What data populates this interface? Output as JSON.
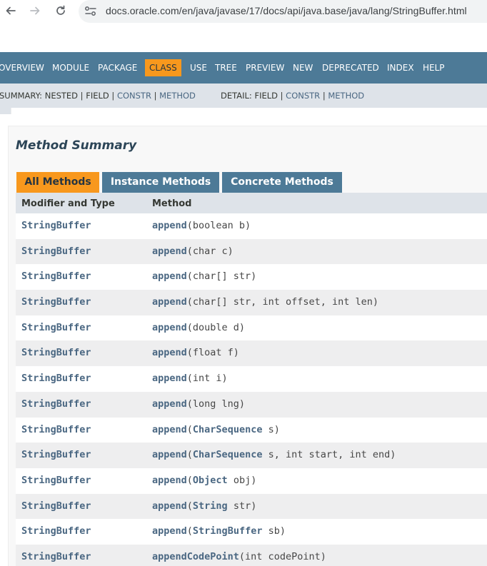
{
  "browser": {
    "url": "docs.oracle.com/en/java/javase/17/docs/api/java.base/java/lang/StringBuffer.html"
  },
  "navbar": {
    "items": [
      "OVERVIEW",
      "MODULE",
      "PACKAGE",
      "CLASS",
      "USE",
      "TREE",
      "PREVIEW",
      "NEW",
      "DEPRECATED",
      "INDEX",
      "HELP"
    ],
    "active": "CLASS"
  },
  "subnav": {
    "summary_prefix": "SUMMARY: NESTED | FIELD | ",
    "summary_constr": "CONSTR",
    "summary_sep": " | ",
    "summary_method": "METHOD",
    "detail_prefix": "DETAIL: FIELD | ",
    "detail_constr": "CONSTR",
    "detail_sep": " | ",
    "detail_method": "METHOD"
  },
  "section": {
    "title": "Method Summary",
    "tabs": [
      "All Methods",
      "Instance Methods",
      "Concrete Methods"
    ],
    "columns": [
      "Modifier and Type",
      "Method"
    ],
    "rows": [
      {
        "type": "StringBuffer",
        "name": "append",
        "sig": [
          [
            "(boolean b)",
            false
          ]
        ]
      },
      {
        "type": "StringBuffer",
        "name": "append",
        "sig": [
          [
            "(char c)",
            false
          ]
        ]
      },
      {
        "type": "StringBuffer",
        "name": "append",
        "sig": [
          [
            "(char[] str)",
            false
          ]
        ]
      },
      {
        "type": "StringBuffer",
        "name": "append",
        "sig": [
          [
            "(char[] str, int offset, int len)",
            false
          ]
        ]
      },
      {
        "type": "StringBuffer",
        "name": "append",
        "sig": [
          [
            "(double d)",
            false
          ]
        ]
      },
      {
        "type": "StringBuffer",
        "name": "append",
        "sig": [
          [
            "(float f)",
            false
          ]
        ]
      },
      {
        "type": "StringBuffer",
        "name": "append",
        "sig": [
          [
            "(int i)",
            false
          ]
        ]
      },
      {
        "type": "StringBuffer",
        "name": "append",
        "sig": [
          [
            "(long lng)",
            false
          ]
        ]
      },
      {
        "type": "StringBuffer",
        "name": "append",
        "sig": [
          [
            "(",
            false
          ],
          [
            "CharSequence",
            true
          ],
          [
            " s)",
            false
          ]
        ]
      },
      {
        "type": "StringBuffer",
        "name": "append",
        "sig": [
          [
            "(",
            false
          ],
          [
            "CharSequence",
            true
          ],
          [
            " s, int start, int end)",
            false
          ]
        ]
      },
      {
        "type": "StringBuffer",
        "name": "append",
        "sig": [
          [
            "(",
            false
          ],
          [
            "Object",
            true
          ],
          [
            " obj)",
            false
          ]
        ]
      },
      {
        "type": "StringBuffer",
        "name": "append",
        "sig": [
          [
            "(",
            false
          ],
          [
            "String",
            true
          ],
          [
            " str)",
            false
          ]
        ]
      },
      {
        "type": "StringBuffer",
        "name": "append",
        "sig": [
          [
            "(",
            false
          ],
          [
            "StringBuffer",
            true
          ],
          [
            " sb)",
            false
          ]
        ]
      },
      {
        "type": "StringBuffer",
        "name": "appendCodePoint",
        "sig": [
          [
            "(int codePoint)",
            false
          ]
        ]
      }
    ]
  },
  "colors": {
    "navbar": "#4d7a97",
    "active_tab": "#f8981d",
    "link": "#4a6782",
    "subnav": "#dee3e9",
    "row_alt": "#eeeeef"
  }
}
